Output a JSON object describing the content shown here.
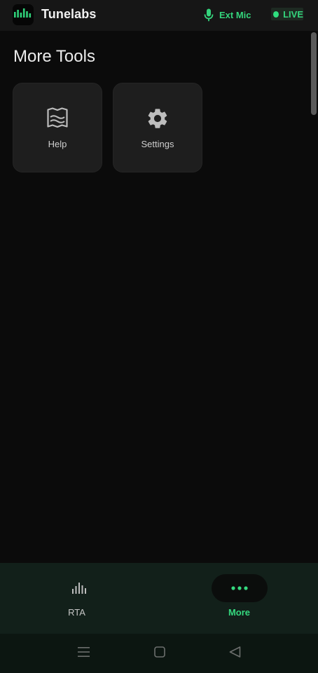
{
  "app": {
    "title": "Tunelabs",
    "accent_color": "#34d47c",
    "logo_icon": "equalizer-bars-icon"
  },
  "status": {
    "mic_label": "Ext Mic",
    "mic_icon": "microphone-icon",
    "live_label": "LIVE"
  },
  "main": {
    "section_title": "More Tools",
    "tools": [
      {
        "label": "Help",
        "icon": "book-map-icon"
      },
      {
        "label": "Settings",
        "icon": "gear-icon"
      }
    ]
  },
  "bottom_nav": {
    "items": [
      {
        "label": "RTA",
        "icon": "bar-chart-icon",
        "active": false
      },
      {
        "label": "More",
        "icon": "more-dots-icon",
        "active": true
      }
    ]
  },
  "system_nav": {
    "buttons": [
      "menu-lines-icon",
      "home-square-icon",
      "back-triangle-icon"
    ]
  }
}
